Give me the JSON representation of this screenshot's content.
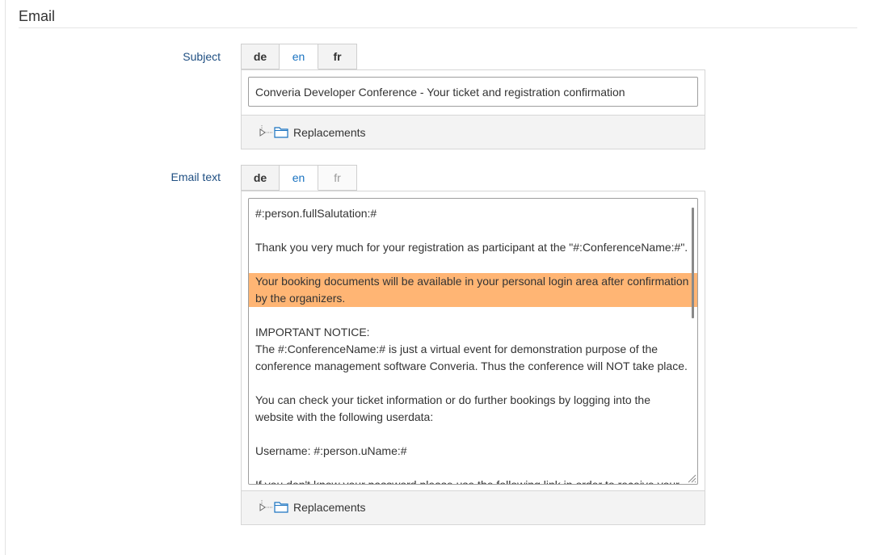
{
  "section": {
    "title": "Email"
  },
  "subject": {
    "label": "Subject",
    "tabs": [
      {
        "label": "de",
        "state": "bold"
      },
      {
        "label": "en",
        "state": "active"
      },
      {
        "label": "fr",
        "state": "bold"
      }
    ],
    "value": "Converia Developer Conference - Your ticket and registration confirmation",
    "replacements_label": "Replacements"
  },
  "email_text": {
    "label": "Email text",
    "tabs": [
      {
        "label": "de",
        "state": "bold"
      },
      {
        "label": "en",
        "state": "active"
      },
      {
        "label": "fr",
        "state": "muted"
      }
    ],
    "lines": [
      "#:person.fullSalutation:#",
      "",
      "Thank you very much for your registration as participant at the \"#:ConferenceName:#\".",
      "",
      "Your booking documents will be available in your personal login area after confirmation",
      "by the organizers.",
      "",
      "IMPORTANT NOTICE:",
      "The #:ConferenceName:# is just a virtual event for demonstration purpose of the",
      "conference management software Converia. Thus the conference will NOT take place.",
      "",
      "You can check your ticket information or do further bookings by logging into the",
      "website with the following userdata:",
      "",
      "Username: #:person.uName:#",
      "",
      "If you don't know your password please use the following link in order to receive your"
    ],
    "highlight_color": "#ffb574",
    "replacements_label": "Replacements"
  },
  "colors": {
    "label": "#1f4f82",
    "active_tab": "#1a73c1",
    "folder_icon": "#1a73c1"
  }
}
